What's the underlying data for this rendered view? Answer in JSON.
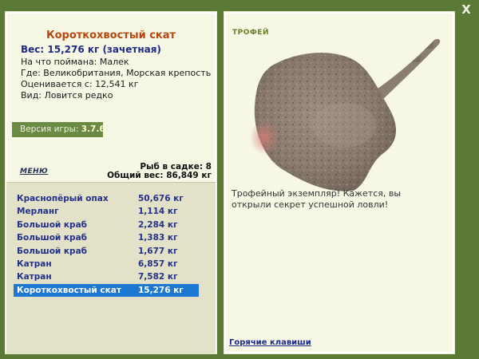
{
  "close_label": "X",
  "fish": {
    "name": "Короткохвостый скат",
    "weight_line": "Вес: 15,276 кг (зачетная)",
    "bait": "На что поймана: Малек",
    "place": "Где: Великобритания, Морская крепость",
    "value": "Оценивается с: 12,541 кг",
    "kind": "Вид: Ловится редко"
  },
  "version": {
    "label": "Версия игры:",
    "number": "3.7.6"
  },
  "menu_label": "МЕНЮ",
  "keepnet": {
    "count_line": "Рыб в садке: 8",
    "total_line": "Общий вес: 86,849 кг"
  },
  "catches": [
    {
      "name": "Краснопёрый опах",
      "weight": "50,676 кг"
    },
    {
      "name": "Мерланг",
      "weight": "1,114 кг"
    },
    {
      "name": "Большой краб",
      "weight": "2,284 кг"
    },
    {
      "name": "Большой краб",
      "weight": "1,383 кг"
    },
    {
      "name": "Большой краб",
      "weight": "1,677 кг"
    },
    {
      "name": "Катран",
      "weight": "6,857 кг"
    },
    {
      "name": "Катран",
      "weight": "7,582 кг"
    },
    {
      "name": "Короткохвостый скат",
      "weight": "15,276 кг"
    }
  ],
  "selected_catch": 7,
  "trophy": {
    "label": "ТРОФЕЙ",
    "message": "Трофейный экземпляр! Кажется, вы открыли секрет успешной ловли!"
  },
  "hotkeys_label": "Горячие клавиши",
  "colors": {
    "frame_green": "#5b7a36",
    "panel_bg": "#f7f7e6",
    "list_bg": "#e3e2c8",
    "fish_name": "#b5470f",
    "weight_blue": "#1f2c84",
    "selection_blue": "#1d78d4"
  },
  "icons": {
    "close": "close-icon",
    "fish": "ray-fish-picture"
  }
}
